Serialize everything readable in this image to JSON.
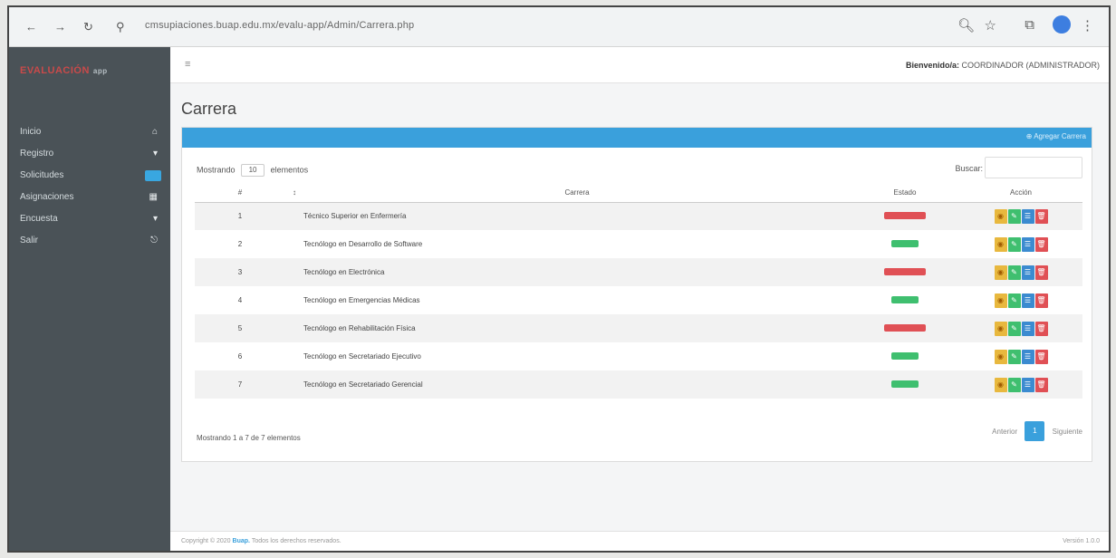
{
  "browser": {
    "url": "cmsupiaciones.buap.edu.mx/evalu-app/Admin/Carrera.php"
  },
  "sidebar": {
    "brand": "EVALUACIÓN",
    "brand_suffix": "app",
    "items": [
      {
        "label": "Inicio",
        "icon": "home-icon"
      },
      {
        "label": "Registro",
        "icon": "chevron-down-icon"
      },
      {
        "label": "Solicitudes",
        "icon": "badge"
      },
      {
        "label": "Asignaciones",
        "icon": "calendar-icon"
      },
      {
        "label": "Encuesta",
        "icon": "chevron-down-icon"
      },
      {
        "label": "Salir",
        "icon": "exit-icon"
      }
    ]
  },
  "topbar": {
    "welcome_prefix": "Bienvenido/a:",
    "welcome_user": "COORDINADOR (ADMINISTRADOR)"
  },
  "page": {
    "title": "Carrera",
    "add_button": "Agregar Carrera"
  },
  "table": {
    "show_prefix": "Mostrando",
    "show_value": "10",
    "show_suffix": "elementos",
    "search_label": "Buscar:",
    "headers": {
      "num": "#",
      "name": "Carrera",
      "state": "Estado",
      "action": "Acción"
    },
    "rows": [
      {
        "num": "1",
        "name": "Técnico Superior en Enfermería",
        "state": "red"
      },
      {
        "num": "2",
        "name": "Tecnólogo en Desarrollo de Software",
        "state": "green"
      },
      {
        "num": "3",
        "name": "Tecnólogo en Electrónica",
        "state": "red"
      },
      {
        "num": "4",
        "name": "Tecnólogo en Emergencias Médicas",
        "state": "green"
      },
      {
        "num": "5",
        "name": "Tecnólogo en Rehabilitación Física",
        "state": "red"
      },
      {
        "num": "6",
        "name": "Tecnólogo en Secretariado Ejecutivo",
        "state": "green"
      },
      {
        "num": "7",
        "name": "Tecnólogo en Secretariado Gerencial",
        "state": "green"
      }
    ],
    "info": "Mostrando 1 a 7 de 7 elementos",
    "pager": {
      "prev": "Anterior",
      "page": "1",
      "next": "Siguiente"
    }
  },
  "footer": {
    "copy_prefix": "Copyright © 2020",
    "copy_brand": "Buap.",
    "copy_suffix": "Todos los derechos reservados.",
    "version": "Versión 1.0.0"
  }
}
